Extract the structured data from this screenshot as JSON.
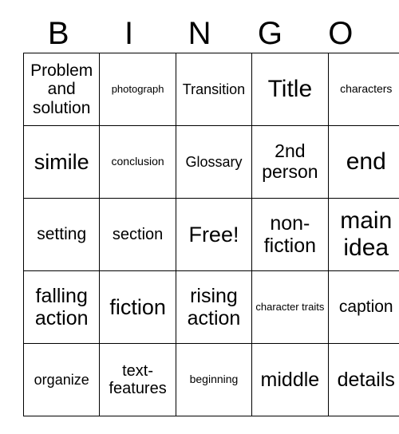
{
  "card": {
    "header_letters": [
      "B",
      "I",
      "N",
      "G",
      "O"
    ],
    "rows": [
      [
        {
          "label": "Problem and solution",
          "size": "fs-21"
        },
        {
          "label": "photograph",
          "size": "fs-13"
        },
        {
          "label": "Transition",
          "size": "fs-18"
        },
        {
          "label": "Title",
          "size": "fs-30"
        },
        {
          "label": "characters",
          "size": "fs-14"
        }
      ],
      [
        {
          "label": "simile",
          "size": "fs-27"
        },
        {
          "label": "conclusion",
          "size": "fs-14"
        },
        {
          "label": "Glossary",
          "size": "fs-18"
        },
        {
          "label": "2nd person",
          "size": "fs-23"
        },
        {
          "label": "end",
          "size": "fs-30"
        }
      ],
      [
        {
          "label": "setting",
          "size": "fs-21"
        },
        {
          "label": "section",
          "size": "fs-20"
        },
        {
          "label": "Free!",
          "size": "fs-27"
        },
        {
          "label": "non-fiction",
          "size": "fs-25"
        },
        {
          "label": "main idea",
          "size": "fs-30"
        }
      ],
      [
        {
          "label": "falling action",
          "size": "fs-25"
        },
        {
          "label": "fiction",
          "size": "fs-27"
        },
        {
          "label": "rising action",
          "size": "fs-25"
        },
        {
          "label": "character traits",
          "size": "fs-13"
        },
        {
          "label": "caption",
          "size": "fs-21"
        }
      ],
      [
        {
          "label": "organize",
          "size": "fs-18"
        },
        {
          "label": "text-features",
          "size": "fs-20"
        },
        {
          "label": "beginning",
          "size": "fs-14"
        },
        {
          "label": "middle",
          "size": "fs-25"
        },
        {
          "label": "details",
          "size": "fs-25"
        }
      ]
    ]
  }
}
